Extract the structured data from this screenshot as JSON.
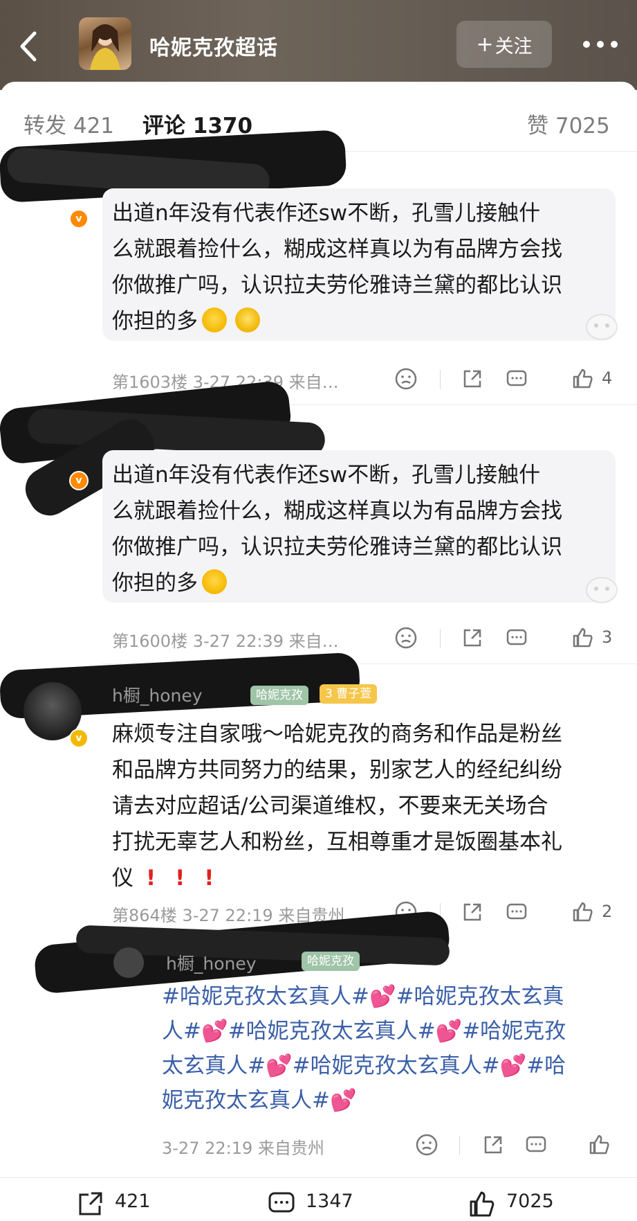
{
  "header": {
    "topic_title": "哈妮克孜超话",
    "follow_label": "关注",
    "follow_plus": "+"
  },
  "tabs": {
    "repost_label": "转发",
    "repost_count": "421",
    "comment_label": "评论",
    "comment_count": "1370",
    "like_label": "赞",
    "like_count": "7025"
  },
  "comments": [
    {
      "text": "出道n年没有代表作还sw不断，孔雪儿接触什么就跟着捡什么，糊成这样真以为有品牌方会找你做推广吗，认识拉夫劳伦雅诗兰黛的都比认识你担的多",
      "lines": [
        "出道n年没有代表作还sw不断，孔雪儿接触什",
        "么就跟着捡什么，糊成这样真以为有品牌方会找",
        "你做推广吗，认识拉夫劳伦雅诗兰黛的都比认识",
        "你担的多"
      ],
      "meta": "第1603楼 3-27 22:39 来自…",
      "likes": "4"
    },
    {
      "text": "出道n年没有代表作还sw不断，孔雪儿接触什么就跟着捡什么，糊成这样真以为有品牌方会找你做推广吗，认识拉夫劳伦雅诗兰黛的都比认识你担的多",
      "lines": [
        "出道n年没有代表作还sw不断，孔雪儿接触什",
        "么就跟着捡什么，糊成这样真以为有品牌方会找",
        "你做推广吗，认识拉夫劳伦雅诗兰黛的都比认识",
        "你担的多"
      ],
      "meta": "第1600楼 3-27 22:39 来自…",
      "likes": "3"
    },
    {
      "username": "h橱_honey",
      "fan_tag": "哈妮克孜",
      "fan_tag2": "曹子萱",
      "fan_level": "3",
      "lines": [
        "麻烦专注自家哦～哈妮克孜的商务和作品是粉丝",
        "和品牌方共同努力的结果，别家艺人的经纪纠纷",
        "请去对应超话/公司渠道维权，不要来无关场合",
        "打扰无辜艺人和粉丝，互相尊重才是饭圈基本礼",
        "仪"
      ],
      "meta": "第864楼 3-27 22:19 来自贵州",
      "likes": "2"
    },
    {
      "username": "h橱_honey",
      "fan_tag": "哈妮克孜",
      "lines": [
        "#哈妮克孜太玄真人#",
        "#哈妮克孜太玄真",
        "人#",
        "#哈妮克孜太玄真人#",
        "#哈妮克孜",
        "太玄真人#",
        "#哈妮克孜太玄真人#",
        "#哈",
        "妮克孜太玄真人#"
      ],
      "meta": "3-27 22:19 来自贵州"
    }
  ],
  "bottom": {
    "repost_count": "421",
    "comment_count": "1347",
    "like_count": "7025"
  },
  "colors": {
    "accent": "#ff8200",
    "hashtag": "#3a5fa8",
    "exclaim": "#e02020"
  }
}
